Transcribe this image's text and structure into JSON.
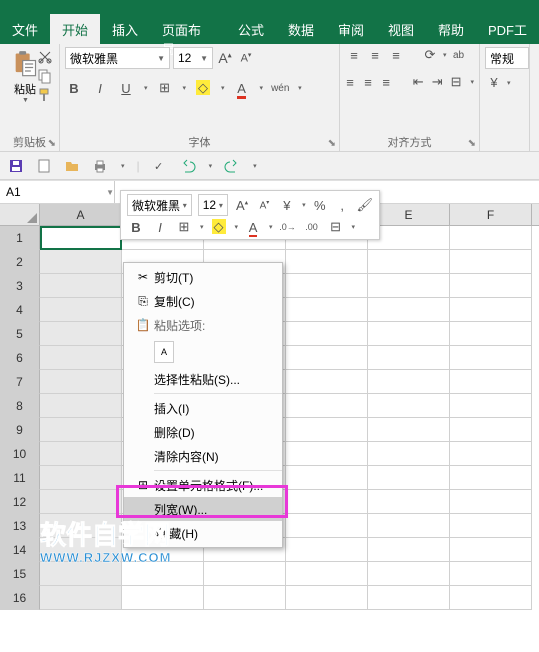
{
  "tabs": [
    "文件",
    "开始",
    "插入",
    "页面布局",
    "公式",
    "数据",
    "审阅",
    "视图",
    "帮助",
    "PDF工"
  ],
  "active_tab": 1,
  "ribbon": {
    "clipboard": {
      "paste": "粘贴",
      "label": "剪贴板"
    },
    "font": {
      "name": "微软雅黑",
      "size": "12",
      "label": "字体",
      "wen": "wén"
    },
    "align": {
      "label": "对齐方式"
    },
    "number": {
      "label": "常规"
    }
  },
  "namebox": "A1",
  "columns": [
    "A",
    "B",
    "C",
    "D",
    "E",
    "F"
  ],
  "rows": [
    "1",
    "2",
    "3",
    "4",
    "5",
    "6",
    "7",
    "8",
    "9",
    "10",
    "11",
    "12",
    "13",
    "14",
    "15",
    "16"
  ],
  "sel_col": 0,
  "minitb": {
    "font": "微软雅黑",
    "size": "12"
  },
  "ctx": {
    "cut": "剪切(T)",
    "copy": "复制(C)",
    "pastehdr": "粘贴选项:",
    "pastespecial": "选择性粘贴(S)...",
    "insert": "插入(I)",
    "delete": "删除(D)",
    "clear": "清除内容(N)",
    "format": "设置单元格格式(F)...",
    "colwidth": "列宽(W)...",
    "hide": "隐    藏(H)"
  },
  "watermark": {
    "line1": "软件自学网",
    "line2": "WWW.RJZXW.COM"
  }
}
